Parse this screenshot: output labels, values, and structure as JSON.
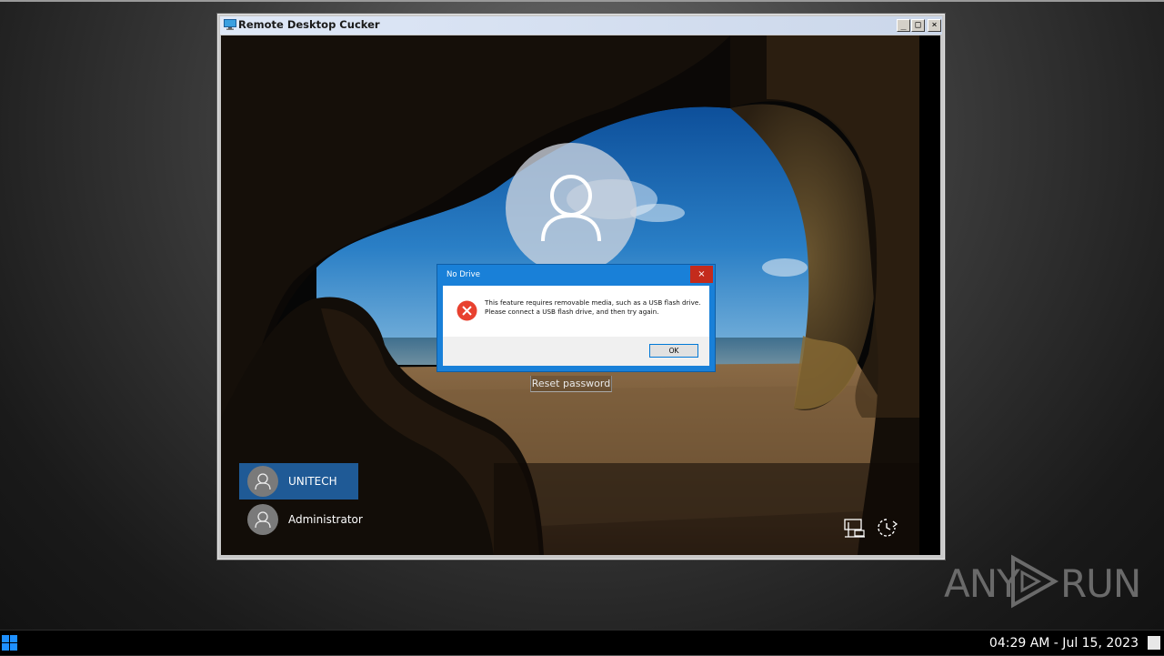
{
  "window": {
    "title": "Remote Desktop Cucker",
    "minimize": "_",
    "maximize": "□",
    "close": "×"
  },
  "lock_screen": {
    "reset_password": "Reset password",
    "users": [
      {
        "name": "UNITECH",
        "selected": true
      },
      {
        "name": "Administrator",
        "selected": false
      }
    ]
  },
  "dialog": {
    "title": "No Drive",
    "close": "×",
    "message": "This feature requires removable media, such as a USB flash drive. Please connect a USB flash drive, and then try again.",
    "ok_label": "OK"
  },
  "watermark": {
    "left": "ANY",
    "right": "RUN"
  },
  "taskbar": {
    "clock": "04:29 AM - Jul 15, 2023"
  },
  "colors": {
    "selected_user": "#1f5a96",
    "dialog_frame": "#1980d8",
    "dialog_close": "#c42b1c",
    "error_icon": "#e8412f"
  }
}
